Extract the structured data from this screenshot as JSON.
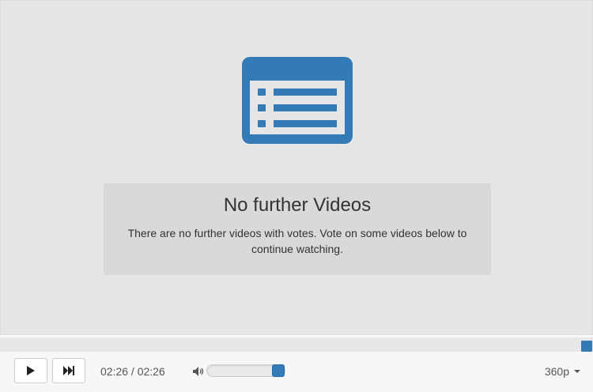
{
  "colors": {
    "accent": "#337ab7",
    "stage_bg": "#e6e6e6",
    "message_bg": "#d9d9d9",
    "controlbar_bg": "#f7f7f7"
  },
  "stage": {
    "icon": "video-list-icon",
    "message": {
      "title": "No further Videos",
      "body": "There are no further videos with votes. Vote on some videos below to continue watching."
    }
  },
  "controls": {
    "progress_percent": 100,
    "play_icon": "play-icon",
    "next_icon": "skip-next-icon",
    "time_current": "02:26",
    "time_separator": " / ",
    "time_total": "02:26",
    "volume_icon": "volume-icon",
    "volume_percent": 100,
    "quality": "360p"
  }
}
